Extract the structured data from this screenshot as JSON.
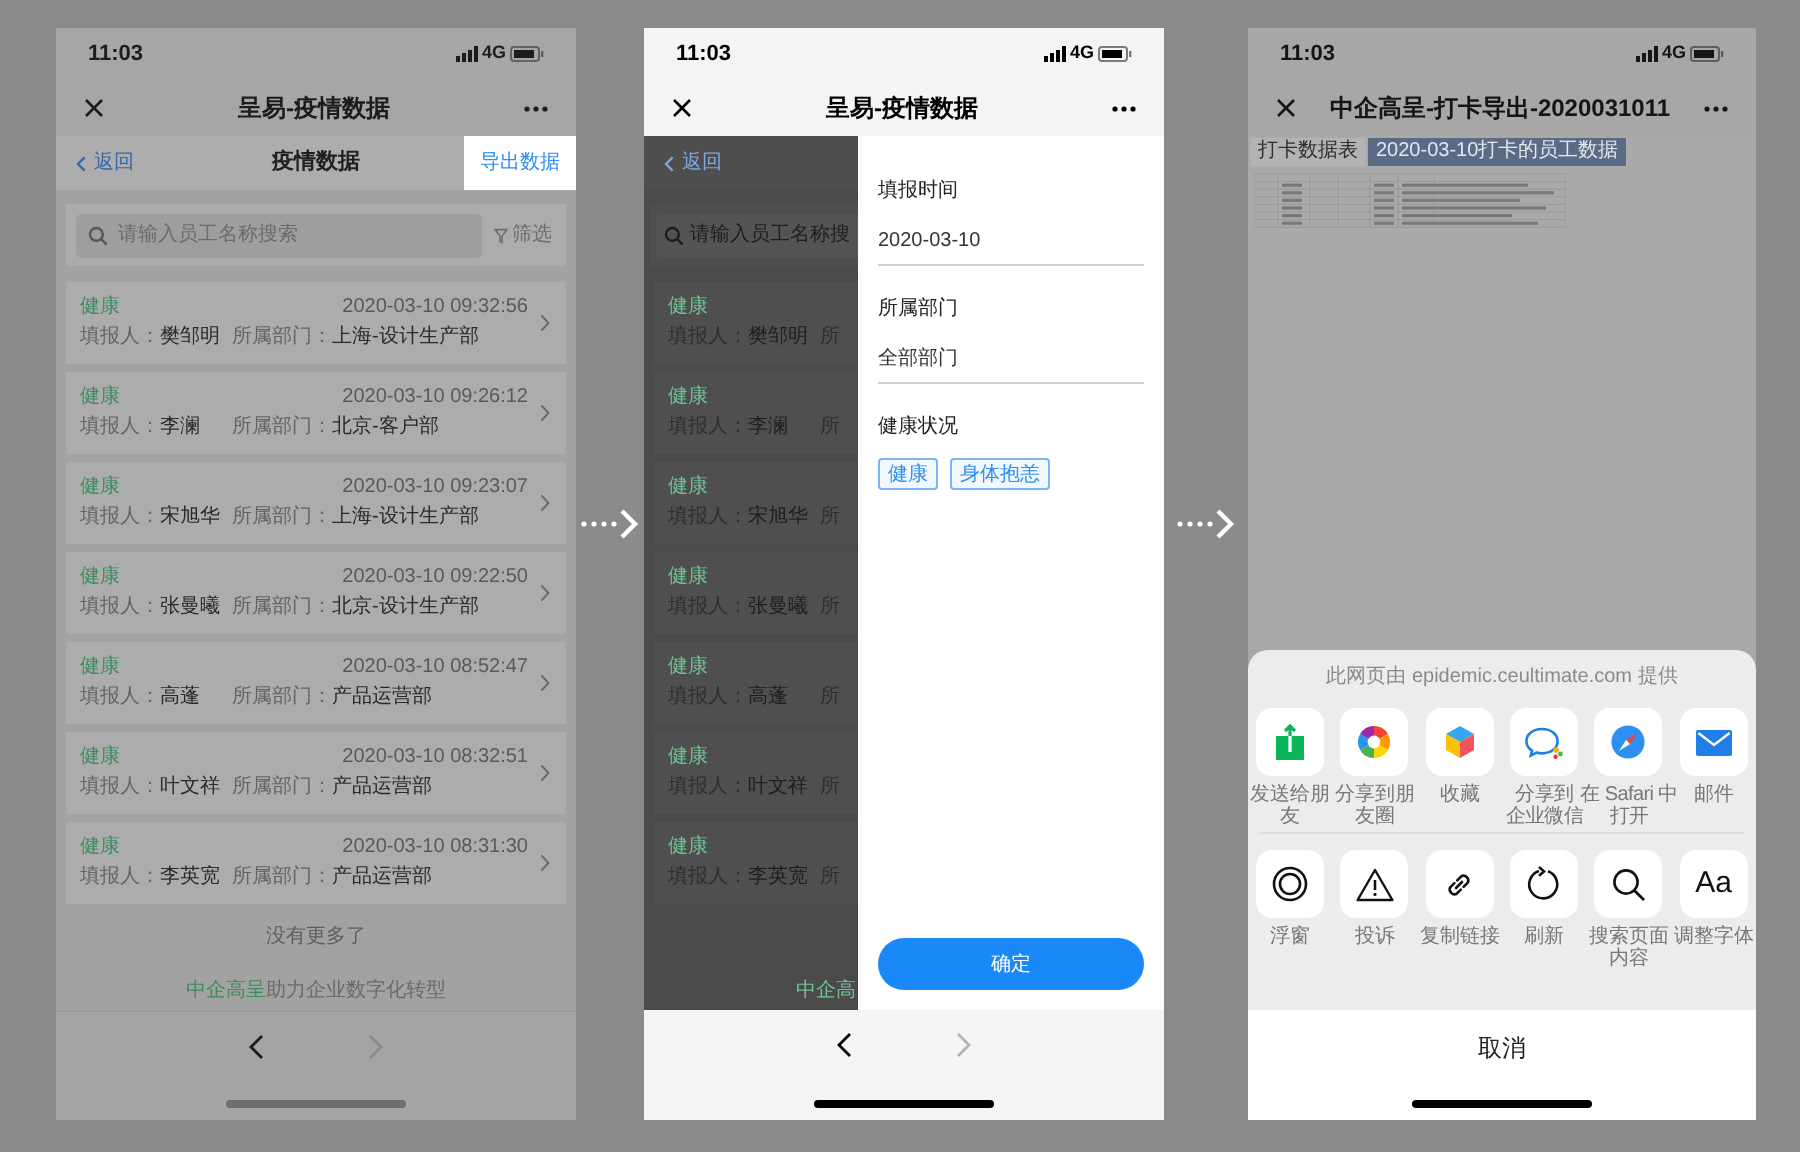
{
  "list_screen": {
    "status_bar": {
      "time": "11:03",
      "network": "4G"
    },
    "nav_title": "呈易-疫情数据",
    "header": {
      "back": "返回",
      "title": "疫情数据",
      "export": "导出数据",
      "export_highlighted": true
    },
    "search": {
      "placeholder": "请输入员工名称搜索",
      "filter": "筛选"
    },
    "records": [
      {
        "status": "健康",
        "time": "2020-03-10 09:32:56",
        "reporter_label": "填报人：",
        "reporter": "樊邹明",
        "dept_label": "所属部门：",
        "dept": "上海-设计生产部"
      },
      {
        "status": "健康",
        "time": "2020-03-10 09:26:12",
        "reporter_label": "填报人：",
        "reporter": "李澜",
        "dept_label": "所属部门：",
        "dept": "北京-客户部"
      },
      {
        "status": "健康",
        "time": "2020-03-10 09:23:07",
        "reporter_label": "填报人：",
        "reporter": "宋旭华",
        "dept_label": "所属部门：",
        "dept": "上海-设计生产部"
      },
      {
        "status": "健康",
        "time": "2020-03-10 09:22:50",
        "reporter_label": "填报人：",
        "reporter": "张曼曦",
        "dept_label": "所属部门：",
        "dept": "北京-设计生产部"
      },
      {
        "status": "健康",
        "time": "2020-03-10 08:52:47",
        "reporter_label": "填报人：",
        "reporter": "高蓬",
        "dept_label": "所属部门：",
        "dept": "产品运营部"
      },
      {
        "status": "健康",
        "time": "2020-03-10 08:32:51",
        "reporter_label": "填报人：",
        "reporter": "叶文祥",
        "dept_label": "所属部门：",
        "dept": "产品运营部"
      },
      {
        "status": "健康",
        "time": "2020-03-10 08:31:30",
        "reporter_label": "填报人：",
        "reporter": "李英宽",
        "dept_label": "所属部门：",
        "dept": "产品运营部"
      }
    ],
    "end_note": "没有更多了",
    "footer": {
      "brand": "中企高呈",
      "slogan": "助力企业数字化转型"
    },
    "toolbar": {
      "back_enabled": true,
      "forward_enabled": false
    }
  },
  "filter_screen": {
    "status_bar": {
      "time": "11:03",
      "network": "4G"
    },
    "nav_title": "呈易-疫情数据",
    "background": {
      "back": "返回",
      "search_placeholder": "请输入员工名称搜",
      "records": [
        {
          "status": "健康",
          "reporter_label": "填报人：",
          "reporter": "樊邹明",
          "dept_label": "所"
        },
        {
          "status": "健康",
          "reporter_label": "填报人：",
          "reporter": "李澜",
          "dept_label": "所"
        },
        {
          "status": "健康",
          "reporter_label": "填报人：",
          "reporter": "宋旭华",
          "dept_label": "所"
        },
        {
          "status": "健康",
          "reporter_label": "填报人：",
          "reporter": "张曼曦",
          "dept_label": "所"
        },
        {
          "status": "健康",
          "reporter_label": "填报人：",
          "reporter": "高蓬",
          "dept_label": "所"
        },
        {
          "status": "健康",
          "reporter_label": "填报人：",
          "reporter": "叶文祥",
          "dept_label": "所"
        },
        {
          "status": "健康",
          "reporter_label": "填报人：",
          "reporter": "李英宽",
          "dept_label": "所"
        }
      ],
      "footer_brand": "中企高"
    },
    "drawer": {
      "fields": [
        {
          "label": "填报时间",
          "value": "2020-03-10"
        },
        {
          "label": "所属部门",
          "value": "全部部门"
        }
      ],
      "health": {
        "label": "健康状况",
        "options": [
          "健康",
          "身体抱恙"
        ]
      },
      "confirm": "确定"
    },
    "toolbar": {
      "back_enabled": true,
      "forward_enabled": false
    }
  },
  "export_screen": {
    "status_bar": {
      "time": "11:03",
      "network": "4G"
    },
    "nav_title": "中企高呈-打卡导出-2020031011",
    "sheet_tabs": [
      {
        "label": "打卡数据表",
        "selected": false
      },
      {
        "label": "2020-03-10打卡的员工数据",
        "selected": true
      }
    ],
    "share_sheet": {
      "source": "此网页由 epidemic.ceultimate.com 提供",
      "rows": [
        [
          {
            "kind": "send",
            "label": "发送给朋友"
          },
          {
            "kind": "moments",
            "label": "分享到朋友圈"
          },
          {
            "kind": "favorite",
            "label": "收藏"
          },
          {
            "kind": "wecom",
            "label": [
              "分享到",
              "企业微信"
            ]
          },
          {
            "kind": "safari",
            "label": [
              "在 Safari 中",
              "打开"
            ]
          },
          {
            "kind": "mail",
            "label": "邮件"
          }
        ],
        [
          {
            "kind": "float",
            "label": "浮窗"
          },
          {
            "kind": "complain",
            "label": "投诉"
          },
          {
            "kind": "copy_link",
            "label": "复制链接"
          },
          {
            "kind": "refresh",
            "label": "刷新"
          },
          {
            "kind": "search",
            "label": "搜索页面内容"
          },
          {
            "kind": "font",
            "label": "调整字体",
            "glyph": "Aa"
          }
        ]
      ],
      "cancel": "取消"
    }
  }
}
